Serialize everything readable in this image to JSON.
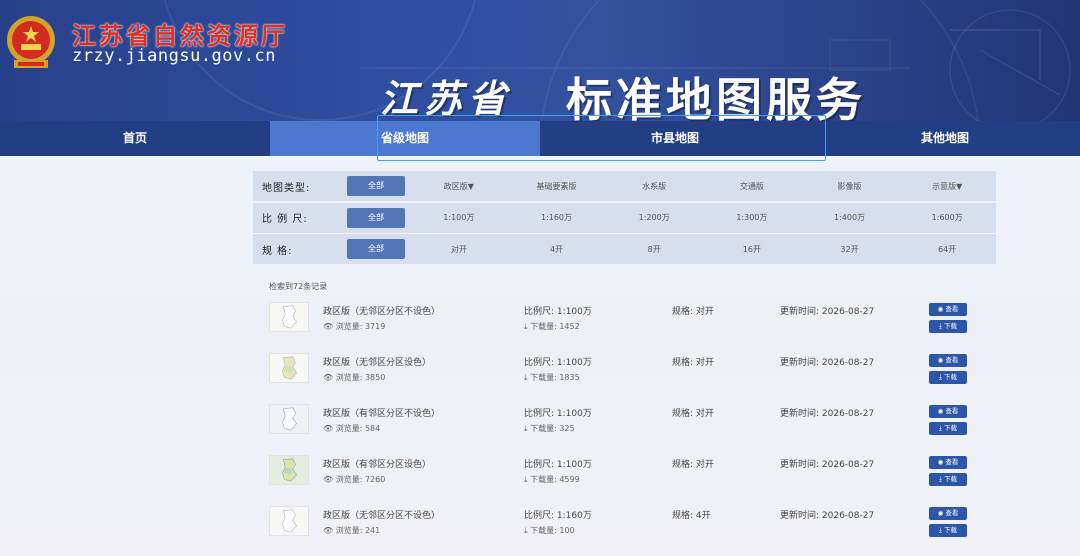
{
  "header": {
    "site_name": "江苏省自然资源厅",
    "domain": "zrzy.jiangsu.gov.cn",
    "banner_province": "江苏省",
    "banner_title": "标准地图服务"
  },
  "nav": {
    "items": [
      {
        "label": "首页"
      },
      {
        "label": "省级地图"
      },
      {
        "label": "市县地图"
      },
      {
        "label": "其他地图"
      }
    ],
    "active_index": 1
  },
  "filters": [
    {
      "label": "地图类型:",
      "all": "全部",
      "options": [
        "政区版▼",
        "基础要素版",
        "水系版",
        "交通版",
        "影像版",
        "示意版▼"
      ]
    },
    {
      "label": "比 例 尺:",
      "all": "全部",
      "options": [
        "1:100万",
        "1:160万",
        "1:200万",
        "1:300万",
        "1:400万",
        "1:600万"
      ]
    },
    {
      "label": "规    格:",
      "all": "全部",
      "options": [
        "对开",
        "4开",
        "8开",
        "16开",
        "32开",
        "64开"
      ]
    }
  ],
  "results": {
    "count_text": "检索到72条记录",
    "view_label": "查看",
    "download_label": "下载",
    "items": [
      {
        "title": "政区版（无邻区分区不设色）",
        "views": "浏览量: 3719",
        "scale": "比例尺: 1:100万",
        "downloads": "下载量: 1452",
        "size": "规格: 对开",
        "updated": "更新时间: 2026-08-27"
      },
      {
        "title": "政区版（无邻区分区设色）",
        "views": "浏览量: 3850",
        "scale": "比例尺: 1:100万",
        "downloads": "下载量: 1835",
        "size": "规格: 对开",
        "updated": "更新时间: 2026-08-27"
      },
      {
        "title": "政区版（有邻区分区不设色）",
        "views": "浏览量: 584",
        "scale": "比例尺: 1:100万",
        "downloads": "下载量: 325",
        "size": "规格: 对开",
        "updated": "更新时间: 2026-08-27"
      },
      {
        "title": "政区版（有邻区分区设色）",
        "views": "浏览量: 7260",
        "scale": "比例尺: 1:100万",
        "downloads": "下载量: 4599",
        "size": "规格: 对开",
        "updated": "更新时间: 2026-08-27"
      },
      {
        "title": "政区版（无邻区分区不设色）",
        "views": "浏览量: 241",
        "scale": "比例尺: 1:160万",
        "downloads": "下载量: 100",
        "size": "规格: 4开",
        "updated": "更新时间: 2026-08-27"
      }
    ]
  },
  "colors": {
    "header_bg": "#2f4ea0",
    "nav_bg": "#223f84",
    "nav_active": "#4d78cf",
    "filter_bg": "#d7deee",
    "button": "#2c56a8",
    "site_name": "#d8312a"
  },
  "icons": [
    "national-emblem-icon",
    "eye-icon",
    "download-icon"
  ]
}
